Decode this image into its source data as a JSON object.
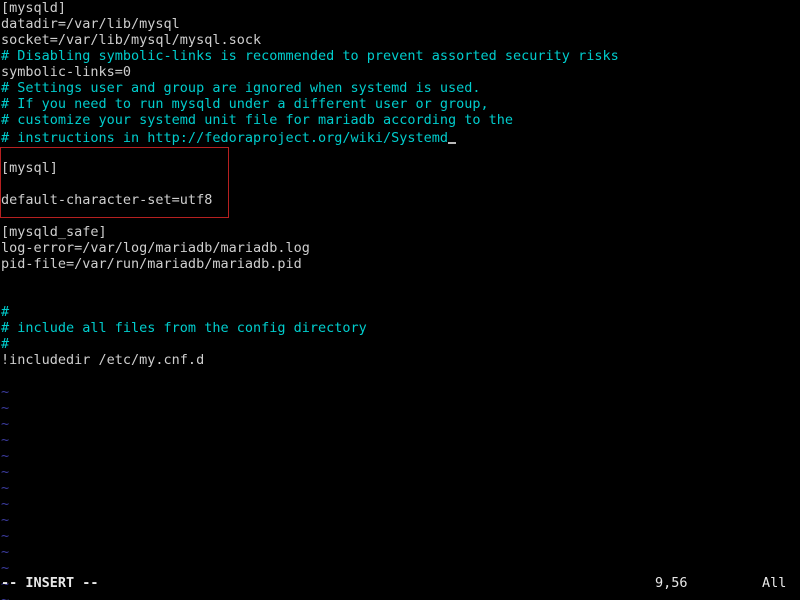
{
  "terminal": {
    "background_color": "#000000",
    "comment_color": "#00cdcd",
    "text_color": "#cfcfcf",
    "tilde_color": "#3b3b9e",
    "highlight_border_color": "#b62020"
  },
  "buffer": {
    "lines": [
      {
        "text": "[mysqld]",
        "kind": "text"
      },
      {
        "text": "datadir=/var/lib/mysql",
        "kind": "text"
      },
      {
        "text": "socket=/var/lib/mysql/mysql.sock",
        "kind": "text"
      },
      {
        "text": "# Disabling symbolic-links is recommended to prevent assorted security risks",
        "kind": "comment"
      },
      {
        "text": "symbolic-links=0",
        "kind": "text"
      },
      {
        "text": "# Settings user and group are ignored when systemd is used.",
        "kind": "comment"
      },
      {
        "text": "# If you need to run mysqld under a different user or group,",
        "kind": "comment"
      },
      {
        "text": "# customize your systemd unit file for mariadb according to the",
        "kind": "comment"
      },
      {
        "text": "# instructions in http://fedoraproject.org/wiki/Systemd",
        "kind": "comment",
        "cursor": true
      },
      {
        "text": "",
        "kind": "blank"
      },
      {
        "text": "[mysql]",
        "kind": "text"
      },
      {
        "text": "",
        "kind": "blank"
      },
      {
        "text": "default-character-set=utf8",
        "kind": "text"
      },
      {
        "text": "",
        "kind": "blank"
      },
      {
        "text": "[mysqld_safe]",
        "kind": "text"
      },
      {
        "text": "log-error=/var/log/mariadb/mariadb.log",
        "kind": "text"
      },
      {
        "text": "pid-file=/var/run/mariadb/mariadb.pid",
        "kind": "text"
      },
      {
        "text": "",
        "kind": "blank"
      },
      {
        "text": "",
        "kind": "blank"
      },
      {
        "text": "#",
        "kind": "comment"
      },
      {
        "text": "# include all files from the config directory",
        "kind": "comment"
      },
      {
        "text": "#",
        "kind": "comment"
      },
      {
        "text": "!includedir /etc/my.cnf.d",
        "kind": "text"
      },
      {
        "text": "",
        "kind": "blank"
      },
      {
        "text": "~",
        "kind": "tilde"
      },
      {
        "text": "~",
        "kind": "tilde"
      },
      {
        "text": "~",
        "kind": "tilde"
      },
      {
        "text": "~",
        "kind": "tilde"
      },
      {
        "text": "~",
        "kind": "tilde"
      },
      {
        "text": "~",
        "kind": "tilde"
      },
      {
        "text": "~",
        "kind": "tilde"
      },
      {
        "text": "~",
        "kind": "tilde"
      },
      {
        "text": "~",
        "kind": "tilde"
      },
      {
        "text": "~",
        "kind": "tilde"
      },
      {
        "text": "~",
        "kind": "tilde"
      },
      {
        "text": "~",
        "kind": "tilde"
      },
      {
        "text": "~",
        "kind": "tilde"
      },
      {
        "text": "~",
        "kind": "tilde"
      }
    ]
  },
  "highlight": {
    "label": "mysql-section-highlight",
    "contains": [
      "[mysql]",
      "default-character-set=utf8"
    ]
  },
  "statusline": {
    "mode": "-- INSERT --",
    "position": "9,56",
    "scroll": "All"
  }
}
